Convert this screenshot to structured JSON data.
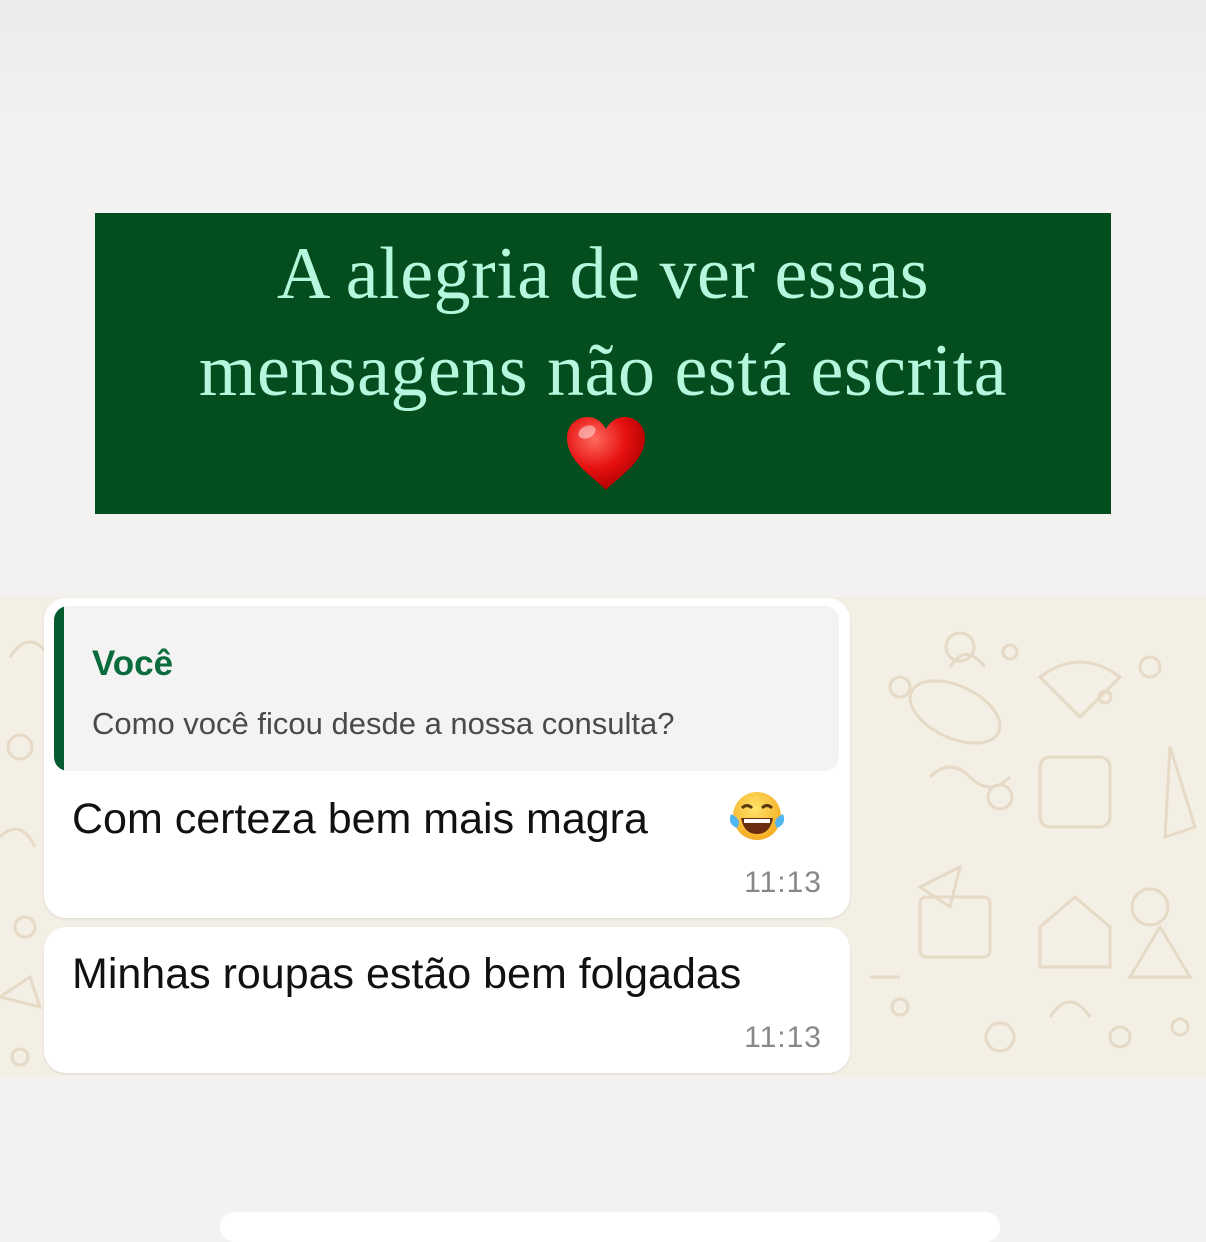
{
  "banner": {
    "line1": "A alegria de ver essas",
    "line2": "mensagens não está escrita",
    "emoji": "red-heart",
    "background_color": "#044d1f",
    "text_color": "#b6f7dd"
  },
  "chat": {
    "messages": [
      {
        "quote": {
          "author": "Você",
          "text": "Como você ficou desde a nossa consulta?"
        },
        "text": "Com certeza bem mais magra",
        "emoji": "face-with-tears-of-joy",
        "time": "11:13"
      },
      {
        "text": "Minhas roupas estão bem folgadas",
        "time": "11:13"
      }
    ],
    "accent_color": "#0a6b3c",
    "wallpaper_color": "#f4efe5"
  }
}
